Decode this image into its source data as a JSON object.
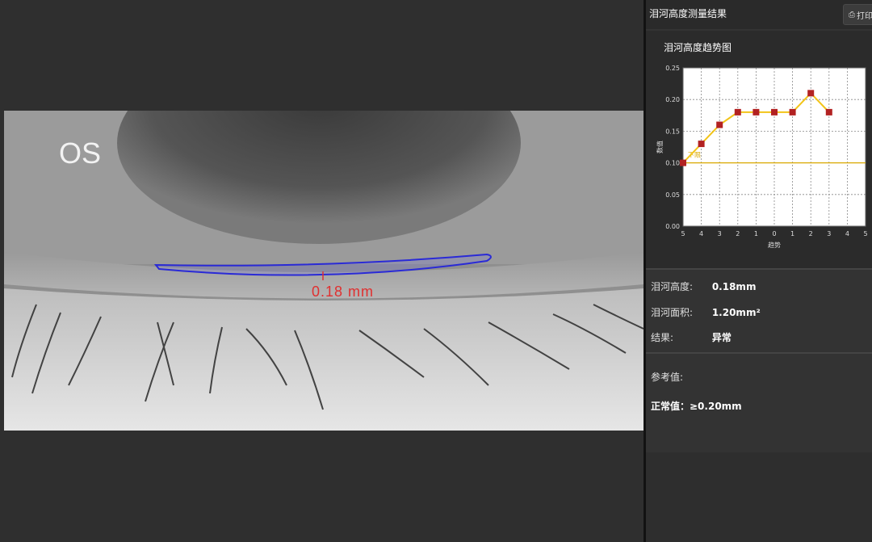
{
  "viewer": {
    "eye_label": "OS",
    "measurement_label": "0.18 mm",
    "outline_color": "#2a2ad6",
    "measurement_color": "#e03030"
  },
  "panel": {
    "title": "泪河高度测量结果",
    "print_button": {
      "icon": "print-icon",
      "label": "打印"
    },
    "info": {
      "height_label": "泪河高度:",
      "height_value": "0.18mm",
      "area_label": "泪河面积:",
      "area_value": "1.20mm²",
      "result_label": "结果:",
      "result_value": "异常"
    },
    "reference": {
      "label": "参考值:",
      "normal": "正常值：≥0.20mm"
    }
  },
  "chart_data": {
    "type": "line",
    "title": "泪河高度趋势图",
    "xlabel": "趋势",
    "ylabel": "数值",
    "categories": [
      "5",
      "4",
      "3",
      "2",
      "1",
      "0",
      "1",
      "2",
      "3",
      "4",
      "5"
    ],
    "series": [
      {
        "values": [
          0.1,
          0.13,
          0.16,
          0.18,
          0.18,
          0.18,
          0.18,
          0.21,
          0.18,
          null,
          null
        ],
        "color": "#f2c418",
        "marker_color": "#b22222"
      }
    ],
    "threshold": {
      "value": 0.1,
      "label": "下限",
      "color": "#d9a800"
    },
    "ylim": [
      0,
      0.25
    ],
    "yticks": [
      "0.00",
      "0.05",
      "0.10",
      "0.15",
      "0.20",
      "0.25"
    ],
    "grid": true
  }
}
